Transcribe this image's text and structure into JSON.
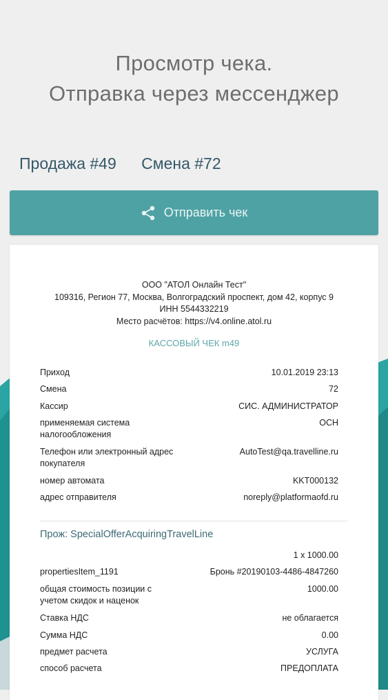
{
  "header": {
    "title_line1": "Просмотр чека.",
    "title_line2": "Отправка через мессенджер"
  },
  "meta": {
    "sale": "Продажа #49",
    "shift": "Смена #72"
  },
  "send_button": {
    "label": "Отправить чек",
    "icon": "share-icon"
  },
  "colors": {
    "background": "#efeff0",
    "accent": "#4ea2a4",
    "teal_shape": "#2a9b99",
    "heading": "#345866"
  },
  "receipt": {
    "org": "ООО \"АТОЛ Онлайн Тест\"",
    "address": "109316, Регион 77, Москва, Волгоградский проспект, дом 42, корпус 9",
    "inn": "ИНН 5544332219",
    "place": "Место расчётов: https://v4.online.atol.ru",
    "title": "КАССОВЫЙ ЧЕК  m49",
    "fields": [
      {
        "label": "Приход",
        "value": "10.01.2019 23:13"
      },
      {
        "label": "Смена",
        "value": "72"
      },
      {
        "label": "Кассир",
        "value": "СИС. АДМИНИСТРАТОР"
      },
      {
        "label": "применяемая система налогообложения",
        "value": "ОСН"
      },
      {
        "label": "Телефон или электронный адрес покупателя",
        "value": "AutoTest@qa.travelline.ru"
      },
      {
        "label": "номер автомата",
        "value": "KKT000132"
      },
      {
        "label": "адрес отправителя",
        "value": "noreply@platformaofd.ru"
      }
    ],
    "item": {
      "name": "Прож: SpecialOfferAcquiringTravelLine",
      "qty_price": "1 x 1000.00",
      "fields": [
        {
          "label": "propertiesItem_1191",
          "value": "Бронь #20190103-4486-4847260"
        },
        {
          "label": "общая стоимость позиции с учетом скидок и наценок",
          "value": "1000.00"
        },
        {
          "label": "Ставка НДС",
          "value": "не облагается"
        },
        {
          "label": "Сумма НДС",
          "value": "0.00"
        },
        {
          "label": "предмет расчета",
          "value": "УСЛУГА"
        },
        {
          "label": "способ расчета",
          "value": "ПРЕДОПЛАТА"
        }
      ]
    }
  }
}
